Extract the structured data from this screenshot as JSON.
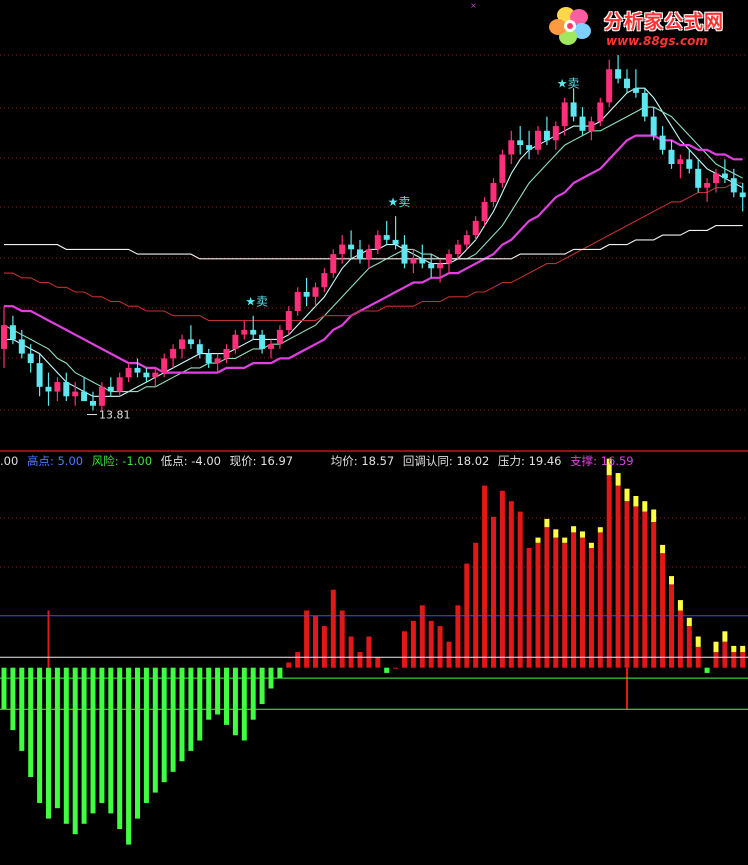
{
  "colors": {
    "background": "#000000",
    "up_candle": "#ff2f7a",
    "down_candle": "#5fe6ee",
    "ma_short": "#c8ffff",
    "ma_mid": "#8fe0c0",
    "ma_purple": "#e040e0",
    "ma_red": "#c03030",
    "ma_white": "#f0f0f0",
    "bar_red": "#e01818",
    "bar_yellow": "#ffff40",
    "bar_green": "#40ff40",
    "line_blue": "#3050ff",
    "line_white": "#f0f0f0",
    "line_green": "#40ff40",
    "divider": "#c01818",
    "grid": "#8b1a1a"
  },
  "logo": {
    "title": "分析家公式网",
    "url": "www.88gs.com",
    "icon": "flower-logo-icon"
  },
  "info_line": {
    "lead": ".00",
    "items": [
      {
        "label": "高点:",
        "value": "5.00",
        "color": "#4a7cff"
      },
      {
        "label": "风险:",
        "value": "-1.00",
        "color": "#40e040"
      },
      {
        "label": "低点:",
        "value": "-4.00",
        "color": "#e0e0e0"
      },
      {
        "label": "现价:",
        "value": "16.97",
        "color": "#e0e0e0"
      },
      {
        "label": "均价:",
        "value": "18.57",
        "color": "#e0e0e0"
      },
      {
        "label": "回调认同:",
        "value": "18.02",
        "color": "#e0e0e0"
      },
      {
        "label": "压力:",
        "value": "19.46",
        "color": "#e0e0e0"
      },
      {
        "label": "支撑:",
        "value": "16.59",
        "color": "#e040e0"
      }
    ]
  },
  "chart_data": [
    {
      "type": "candlestick",
      "low_label": "13.81",
      "signals": [
        {
          "index": 28,
          "text": "★卖"
        },
        {
          "index": 44,
          "text": "★卖"
        },
        {
          "index": 63,
          "text": "★卖"
        }
      ],
      "candles": [
        [
          15.1,
          16.0,
          14.7,
          15.6
        ],
        [
          15.6,
          15.8,
          15.2,
          15.3
        ],
        [
          15.3,
          15.5,
          14.9,
          15.0
        ],
        [
          15.0,
          15.2,
          14.6,
          14.8
        ],
        [
          14.8,
          15.0,
          14.1,
          14.3
        ],
        [
          14.3,
          14.6,
          13.9,
          14.2
        ],
        [
          14.2,
          14.5,
          14.0,
          14.4
        ],
        [
          14.4,
          14.6,
          14.0,
          14.1
        ],
        [
          14.1,
          14.4,
          13.9,
          14.2
        ],
        [
          14.2,
          14.5,
          14.0,
          14.0
        ],
        [
          14.0,
          14.2,
          13.8,
          13.9
        ],
        [
          13.9,
          14.4,
          13.8,
          14.3
        ],
        [
          14.3,
          14.5,
          14.1,
          14.2
        ],
        [
          14.2,
          14.6,
          14.1,
          14.5
        ],
        [
          14.5,
          14.8,
          14.4,
          14.7
        ],
        [
          14.7,
          14.9,
          14.5,
          14.6
        ],
        [
          14.6,
          14.7,
          14.4,
          14.5
        ],
        [
          14.5,
          14.7,
          14.3,
          14.6
        ],
        [
          14.6,
          15.0,
          14.5,
          14.9
        ],
        [
          14.9,
          15.2,
          14.7,
          15.1
        ],
        [
          15.1,
          15.4,
          14.9,
          15.3
        ],
        [
          15.3,
          15.6,
          15.1,
          15.2
        ],
        [
          15.2,
          15.3,
          14.9,
          15.0
        ],
        [
          15.0,
          15.1,
          14.7,
          14.8
        ],
        [
          14.8,
          15.0,
          14.6,
          14.9
        ],
        [
          14.9,
          15.2,
          14.8,
          15.1
        ],
        [
          15.1,
          15.5,
          15.0,
          15.4
        ],
        [
          15.4,
          15.7,
          15.3,
          15.5
        ],
        [
          15.5,
          15.8,
          15.3,
          15.4
        ],
        [
          15.4,
          15.5,
          15.0,
          15.1
        ],
        [
          15.1,
          15.3,
          14.9,
          15.2
        ],
        [
          15.2,
          15.6,
          15.1,
          15.5
        ],
        [
          15.5,
          16.0,
          15.4,
          15.9
        ],
        [
          15.9,
          16.4,
          15.8,
          16.3
        ],
        [
          16.3,
          16.6,
          16.0,
          16.2
        ],
        [
          16.2,
          16.5,
          16.0,
          16.4
        ],
        [
          16.4,
          16.8,
          16.3,
          16.7
        ],
        [
          16.7,
          17.2,
          16.6,
          17.1
        ],
        [
          17.1,
          17.5,
          16.9,
          17.3
        ],
        [
          17.3,
          17.6,
          17.0,
          17.2
        ],
        [
          17.2,
          17.4,
          16.9,
          17.0
        ],
        [
          17.0,
          17.3,
          16.8,
          17.2
        ],
        [
          17.2,
          17.6,
          17.1,
          17.5
        ],
        [
          17.5,
          17.8,
          17.3,
          17.4
        ],
        [
          17.4,
          17.9,
          17.2,
          17.3
        ],
        [
          17.3,
          17.5,
          16.8,
          16.9
        ],
        [
          16.9,
          17.2,
          16.7,
          17.0
        ],
        [
          17.0,
          17.3,
          16.8,
          16.9
        ],
        [
          16.9,
          17.1,
          16.6,
          16.8
        ],
        [
          16.8,
          17.0,
          16.5,
          16.9
        ],
        [
          16.9,
          17.2,
          16.7,
          17.1
        ],
        [
          17.1,
          17.4,
          17.0,
          17.3
        ],
        [
          17.3,
          17.6,
          17.2,
          17.5
        ],
        [
          17.5,
          17.9,
          17.4,
          17.8
        ],
        [
          17.8,
          18.3,
          17.7,
          18.2
        ],
        [
          18.2,
          18.7,
          18.1,
          18.6
        ],
        [
          18.6,
          19.3,
          18.5,
          19.2
        ],
        [
          19.2,
          19.7,
          19.0,
          19.5
        ],
        [
          19.5,
          19.8,
          19.2,
          19.4
        ],
        [
          19.4,
          19.7,
          19.1,
          19.3
        ],
        [
          19.3,
          19.8,
          19.2,
          19.7
        ],
        [
          19.7,
          20.0,
          19.4,
          19.5
        ],
        [
          19.5,
          19.9,
          19.3,
          19.8
        ],
        [
          19.8,
          20.4,
          19.6,
          20.3
        ],
        [
          20.3,
          20.6,
          19.9,
          20.0
        ],
        [
          20.0,
          20.2,
          19.6,
          19.7
        ],
        [
          19.7,
          20.0,
          19.5,
          19.9
        ],
        [
          19.9,
          20.4,
          19.8,
          20.3
        ],
        [
          20.3,
          21.2,
          20.2,
          21.0
        ],
        [
          21.0,
          21.3,
          20.7,
          20.8
        ],
        [
          20.8,
          21.0,
          20.5,
          20.6
        ],
        [
          20.6,
          21.0,
          20.4,
          20.5
        ],
        [
          20.5,
          20.6,
          19.9,
          20.0
        ],
        [
          20.0,
          20.2,
          19.5,
          19.6
        ],
        [
          19.6,
          19.8,
          19.2,
          19.3
        ],
        [
          19.3,
          19.5,
          18.9,
          19.0
        ],
        [
          19.0,
          19.2,
          18.7,
          19.1
        ],
        [
          19.1,
          19.3,
          18.8,
          18.9
        ],
        [
          18.9,
          19.1,
          18.4,
          18.5
        ],
        [
          18.5,
          18.7,
          18.2,
          18.6
        ],
        [
          18.6,
          18.9,
          18.4,
          18.8
        ],
        [
          18.8,
          19.1,
          18.6,
          18.7
        ],
        [
          18.7,
          18.9,
          18.3,
          18.4
        ],
        [
          18.4,
          18.6,
          18.0,
          18.3
        ]
      ],
      "moving_averages": [
        {
          "color": "#c8ffff",
          "values": [
            15.3,
            15.3,
            15.2,
            15.1,
            15.0,
            14.8,
            14.6,
            14.4,
            14.3,
            14.2,
            14.1,
            14.1,
            14.1,
            14.1,
            14.2,
            14.3,
            14.4,
            14.5,
            14.6,
            14.7,
            14.8,
            14.9,
            15.0,
            15.0,
            15.0,
            15.0,
            15.1,
            15.2,
            15.3,
            15.3,
            15.3,
            15.3,
            15.4,
            15.6,
            15.8,
            16.0,
            16.2,
            16.5,
            16.8,
            17.0,
            17.1,
            17.2,
            17.2,
            17.3,
            17.3,
            17.2,
            17.1,
            17.0,
            16.9,
            16.9,
            16.9,
            17.0,
            17.2,
            17.4,
            17.7,
            18.0,
            18.4,
            18.8,
            19.1,
            19.3,
            19.4,
            19.5,
            19.6,
            19.7,
            19.8,
            19.8,
            19.8,
            19.9,
            20.1,
            20.3,
            20.5,
            20.6,
            20.6,
            20.4,
            20.1,
            19.8,
            19.5,
            19.3,
            19.1,
            18.9,
            18.8,
            18.7,
            18.6,
            18.5
          ]
        },
        {
          "color": "#8fe0c0",
          "values": [
            15.6,
            15.5,
            15.4,
            15.3,
            15.2,
            15.1,
            14.9,
            14.8,
            14.6,
            14.5,
            14.4,
            14.3,
            14.2,
            14.2,
            14.2,
            14.2,
            14.3,
            14.3,
            14.4,
            14.5,
            14.6,
            14.7,
            14.7,
            14.8,
            14.8,
            14.9,
            14.9,
            15.0,
            15.1,
            15.1,
            15.2,
            15.2,
            15.3,
            15.4,
            15.5,
            15.6,
            15.8,
            16.0,
            16.2,
            16.4,
            16.6,
            16.8,
            16.9,
            17.0,
            17.1,
            17.2,
            17.2,
            17.1,
            17.1,
            17.0,
            17.0,
            17.0,
            17.0,
            17.1,
            17.3,
            17.5,
            17.7,
            18.0,
            18.3,
            18.6,
            18.8,
            19.0,
            19.2,
            19.4,
            19.5,
            19.6,
            19.7,
            19.7,
            19.8,
            19.9,
            20.0,
            20.1,
            20.2,
            20.2,
            20.1,
            20.0,
            19.8,
            19.6,
            19.4,
            19.2,
            19.0,
            18.9,
            18.8,
            18.7
          ]
        },
        {
          "color": "#e040e0",
          "values": [
            16.0,
            16.0,
            15.9,
            15.9,
            15.8,
            15.7,
            15.6,
            15.5,
            15.4,
            15.3,
            15.2,
            15.1,
            15.0,
            14.9,
            14.8,
            14.8,
            14.7,
            14.7,
            14.6,
            14.6,
            14.6,
            14.6,
            14.6,
            14.6,
            14.6,
            14.7,
            14.7,
            14.7,
            14.8,
            14.8,
            14.8,
            14.9,
            14.9,
            15.0,
            15.1,
            15.2,
            15.3,
            15.5,
            15.6,
            15.8,
            15.9,
            16.0,
            16.1,
            16.2,
            16.3,
            16.4,
            16.5,
            16.5,
            16.6,
            16.6,
            16.7,
            16.7,
            16.8,
            16.9,
            17.0,
            17.1,
            17.3,
            17.4,
            17.6,
            17.8,
            17.9,
            18.1,
            18.3,
            18.4,
            18.6,
            18.7,
            18.8,
            18.9,
            19.1,
            19.3,
            19.5,
            19.6,
            19.6,
            19.6,
            19.5,
            19.5,
            19.4,
            19.4,
            19.3,
            19.3,
            19.2,
            19.2,
            19.1,
            19.1
          ]
        },
        {
          "color": "#c03030",
          "values": [
            16.7,
            16.7,
            16.6,
            16.6,
            16.5,
            16.5,
            16.4,
            16.4,
            16.3,
            16.3,
            16.2,
            16.2,
            16.1,
            16.1,
            16.0,
            16.0,
            15.9,
            15.9,
            15.9,
            15.8,
            15.8,
            15.8,
            15.8,
            15.7,
            15.7,
            15.7,
            15.7,
            15.7,
            15.7,
            15.7,
            15.7,
            15.7,
            15.7,
            15.7,
            15.7,
            15.7,
            15.8,
            15.8,
            15.8,
            15.8,
            15.9,
            15.9,
            15.9,
            16.0,
            16.0,
            16.0,
            16.0,
            16.1,
            16.1,
            16.1,
            16.2,
            16.2,
            16.2,
            16.3,
            16.3,
            16.4,
            16.5,
            16.5,
            16.6,
            16.7,
            16.8,
            16.9,
            16.9,
            17.0,
            17.1,
            17.2,
            17.3,
            17.4,
            17.5,
            17.6,
            17.7,
            17.8,
            17.9,
            18.0,
            18.1,
            18.2,
            18.2,
            18.3,
            18.4,
            18.4,
            18.5,
            18.5,
            18.6,
            18.6
          ]
        },
        {
          "color": "#f0f0f0",
          "values": [
            17.3,
            17.3,
            17.3,
            17.3,
            17.3,
            17.3,
            17.3,
            17.2,
            17.2,
            17.2,
            17.2,
            17.2,
            17.2,
            17.2,
            17.2,
            17.1,
            17.1,
            17.1,
            17.1,
            17.1,
            17.1,
            17.1,
            17.0,
            17.0,
            17.0,
            17.0,
            17.0,
            17.0,
            17.0,
            17.0,
            17.0,
            17.0,
            17.0,
            17.0,
            17.0,
            17.0,
            17.0,
            17.0,
            17.0,
            17.0,
            17.0,
            17.0,
            17.0,
            17.0,
            17.0,
            17.0,
            17.0,
            17.0,
            17.0,
            17.0,
            17.0,
            17.0,
            17.0,
            17.0,
            17.0,
            17.0,
            17.0,
            17.0,
            17.1,
            17.1,
            17.1,
            17.1,
            17.1,
            17.1,
            17.2,
            17.2,
            17.2,
            17.2,
            17.3,
            17.3,
            17.3,
            17.4,
            17.4,
            17.4,
            17.5,
            17.5,
            17.5,
            17.6,
            17.6,
            17.6,
            17.7,
            17.7,
            17.7,
            17.7
          ]
        }
      ]
    },
    {
      "type": "bar",
      "reference_lines": [
        {
          "value": 5.0,
          "color": "#3050ff"
        },
        {
          "value": 1.0,
          "color": "#f0f0f0"
        },
        {
          "value": -1.0,
          "color": "#40ff40"
        },
        {
          "value": -4.0,
          "color": "#40ff40"
        }
      ],
      "ylim": [
        -18,
        19
      ],
      "values": [
        -4.0,
        -6.0,
        -8.0,
        -10.5,
        -13.0,
        -14.5,
        -13.5,
        -15.0,
        -16.0,
        -15.0,
        -14.0,
        -13.0,
        -14.0,
        -15.5,
        -17.0,
        -14.5,
        -13.0,
        -12.0,
        -11.0,
        -10.0,
        -9.0,
        -8.0,
        -7.0,
        -5.0,
        -4.5,
        -5.5,
        -6.5,
        -7.0,
        -5.0,
        -3.5,
        -2.0,
        -1.0,
        0.5,
        1.5,
        5.5,
        5.0,
        4.0,
        7.5,
        5.5,
        3.0,
        1.5,
        3.0,
        1.0,
        -0.5,
        0.0,
        3.5,
        4.5,
        6.0,
        4.5,
        4.0,
        2.5,
        6.0,
        10.0,
        12.0,
        17.5,
        14.5,
        17.0,
        16.0,
        15.0,
        11.5,
        12.0,
        13.5,
        12.5,
        12.0,
        13.0,
        12.5,
        11.5,
        13.0,
        18.5,
        17.5,
        16.0,
        15.5,
        15.0,
        14.0,
        11.0,
        8.0,
        5.5,
        4.0,
        2.0,
        -0.5,
        1.5,
        2.5,
        1.5,
        1.5
      ],
      "highlights": [
        0,
        0,
        0,
        0,
        0,
        0,
        0,
        0,
        0,
        0,
        0,
        0,
        0,
        0,
        0,
        0,
        0,
        0,
        0,
        0,
        0,
        0,
        0,
        0,
        0,
        0,
        0,
        0,
        0,
        0,
        0,
        0,
        0,
        0,
        0,
        0,
        0,
        0,
        0,
        0,
        0,
        0,
        0,
        0,
        0,
        0,
        0,
        0,
        0,
        0,
        0,
        0,
        0,
        0,
        0,
        0,
        0,
        0,
        0,
        0,
        0.5,
        0.8,
        0.8,
        0.5,
        0.6,
        0.6,
        0.5,
        0.5,
        1.6,
        1.2,
        1.2,
        1.0,
        1.0,
        1.2,
        0.8,
        0.8,
        1.0,
        0.8,
        1.0,
        0,
        1.0,
        1.0,
        0.6,
        0.6
      ],
      "spikes": [
        {
          "index": 5,
          "value": 5.5
        },
        {
          "index": 70,
          "value": -4.0
        }
      ]
    }
  ]
}
